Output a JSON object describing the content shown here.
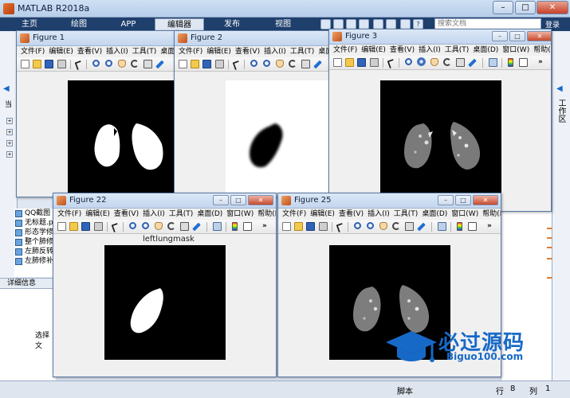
{
  "main_window": {
    "title": "MATLAB R2018a",
    "tabs": [
      "主页",
      "绘图",
      "APP",
      "编辑器",
      "发布",
      "视图"
    ],
    "active_tab": "编辑器",
    "search_placeholder": "搜索文档",
    "login": "登录",
    "left_partial": "当",
    "workspace_label": "工作区",
    "files": [
      "QQ截图",
      "无标题.p",
      "形态学修",
      "整个肺修",
      "左肺反转",
      "左肺修补"
    ],
    "detail_header": "详细信息",
    "detail_partial": "选择文",
    "status": {
      "script": "脚本",
      "row_label": "行",
      "row": "8",
      "col_label": "列",
      "col": "1"
    },
    "colors": {
      "tab_bar": "#1f3f6d",
      "accent": "#1769c8"
    }
  },
  "figures": [
    {
      "id": "fig1",
      "title": "Figure 1",
      "menu": [
        "文件(F)",
        "编辑(E)",
        "查看(V)",
        "插入(I)",
        "工具(T)",
        "桌面(D)"
      ],
      "image": "binary lungs mask"
    },
    {
      "id": "fig2",
      "title": "Figure 2",
      "menu": [
        "文件(F)",
        "编辑(E)",
        "查看(V)",
        "插入(I)",
        "工具(T)",
        "桌面(D"
      ],
      "image": "inverted left lung mask"
    },
    {
      "id": "fig3",
      "title": "Figure 3",
      "menu": [
        "文件(F)",
        "编辑(E)",
        "查看(V)",
        "插入(I)",
        "工具(T)",
        "桌面(D)",
        "窗口(W)",
        "帮助(H)"
      ],
      "image": "grayscale lungs CT"
    },
    {
      "id": "fig22",
      "title": "Figure 22",
      "menu": [
        "文件(F)",
        "编辑(E)",
        "查看(V)",
        "插入(I)",
        "工具(T)",
        "桌面(D)",
        "窗口(W)",
        "帮助(H)"
      ],
      "caption": "leftlungmask",
      "image": "left lung mask"
    },
    {
      "id": "fig25",
      "title": "Figure 25",
      "menu": [
        "文件(F)",
        "编辑(E)",
        "查看(V)",
        "插入(I)",
        "工具(T)",
        "桌面(D)",
        "窗口(W)",
        "帮助(H)"
      ],
      "image": "lungs CT with watermark"
    }
  ],
  "window_buttons": {
    "minimize": "–",
    "maximize": "□",
    "close": "✕"
  },
  "toolbar_more": "»",
  "watermark": {
    "text": "必过源码",
    "url": "Biguo100.com"
  }
}
